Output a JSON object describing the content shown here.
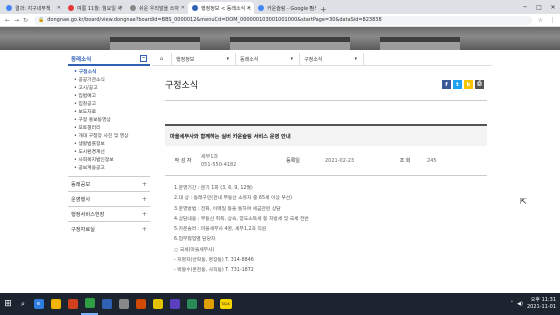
{
  "browser": {
    "tabs": [
      {
        "label": "결과: 지구내부책",
        "color": "#4285f4",
        "active": false
      },
      {
        "label": "여름 11월: 월요일 사",
        "color": "#e53935",
        "active": false
      },
      {
        "label": "쉬운 우리말을 쓰자",
        "color": "#888888",
        "active": false
      },
      {
        "label": "행정정보 < 동래소식 <",
        "color": "#2f62b5",
        "active": true
      },
      {
        "label": "카운슬링 - Google 검색",
        "color": "#4285f4",
        "active": false
      }
    ],
    "new_tab": "+",
    "url": "dongnae.go.kr/board/view.dongnae?boardId=BBS_0000012&menuCd=DOM_000000103001001000&startPage=30&dataSid=823838"
  },
  "sidebar": {
    "header": "동래소식",
    "header_toggle": "−",
    "sub_items": [
      {
        "label": "구청소식",
        "current": true
      },
      {
        "label": "공공기관소식",
        "current": false
      },
      {
        "label": "고시/공고",
        "current": false
      },
      {
        "label": "입법예고",
        "current": false
      },
      {
        "label": "입찰공고",
        "current": false
      },
      {
        "label": "보도자료",
        "current": false
      },
      {
        "label": "구정 홍보동영상",
        "current": false
      },
      {
        "label": "포토갤러리",
        "current": false
      },
      {
        "label": "개대 구청장 사진 및 영상",
        "current": false
      },
      {
        "label": "생활법률정보",
        "current": false
      },
      {
        "label": "도시환경계선",
        "current": false
      },
      {
        "label": "사회복지법인정보",
        "current": false
      },
      {
        "label": "공보계용공고",
        "current": false
      }
    ],
    "categories": [
      {
        "label": "동래공보",
        "plus": "+"
      },
      {
        "label": "운영행사",
        "plus": "+"
      },
      {
        "label": "행정서비스헌장",
        "plus": "+"
      },
      {
        "label": "구정자료실",
        "plus": "+"
      }
    ]
  },
  "breadcrumb": {
    "items": [
      "행정정보",
      "동래소식",
      "구정소식"
    ],
    "arrow": "▾"
  },
  "page": {
    "title": "구정소식"
  },
  "sns": [
    {
      "icon": "f",
      "color": "#3b5998"
    },
    {
      "icon": "t",
      "color": "#1da1f2"
    },
    {
      "icon": "k",
      "color": "#f7c600"
    },
    {
      "icon": "⎙",
      "color": "#555555"
    }
  ],
  "post": {
    "title": "마을세무사와 함께하는 실버 카운슬링 서비스 운영 안내",
    "author_label": "작 성 자",
    "author_dept": "세무1과",
    "author_phone": "051-550-4182",
    "date_label": "등록일",
    "date": "2021-02-23",
    "views_label": "조 회",
    "views": "245",
    "body_lines": [
      "1.운영기간 : 분기 1회 (3, 6, 9, 12월)",
      "2.대 상 : 동래구민(관내 부동산 소유자 중 65세 이상 우선)",
      "3.운영방법 : 전화, 이메일 등을 통하여 세금관련 상담",
      "4.상담내용 : 부동산 취득, 상속, 양도소득세 등 지방세 및 국세 전반",
      "5.카운슬러 : 마을세무사 4명, 세무1,2과 직원",
      "6.업무협업별 담당자",
      "○ 국세(마을세무사)",
      "- 지명자(안락동, 명장동) T. 314-8846",
      "- 박봉수(온천동, 사직동) T. 731-1872"
    ]
  },
  "taskbar": {
    "apps": [
      {
        "label": "e",
        "color": "#2f7de1",
        "active": false
      },
      {
        "label": "",
        "color": "#f0b400",
        "active": false
      },
      {
        "label": "",
        "color": "#d04020",
        "active": false
      },
      {
        "label": "",
        "color": "#2f9e44",
        "active": true
      },
      {
        "label": "",
        "color": "#2f62b5",
        "active": false
      },
      {
        "label": "",
        "color": "#888888",
        "active": false
      },
      {
        "label": "",
        "color": "#d04a02",
        "active": false
      },
      {
        "label": "",
        "color": "#e3c000",
        "active": false
      },
      {
        "label": "",
        "color": "#5c3fbf",
        "active": false
      },
      {
        "label": "",
        "color": "#2a8a5a",
        "active": false
      },
      {
        "label": "",
        "color": "#e0a000",
        "active": false
      },
      {
        "label": "TALK",
        "color": "#f6d500",
        "active": false
      }
    ],
    "time": "오후 11:31",
    "date": "2021-11-01"
  }
}
